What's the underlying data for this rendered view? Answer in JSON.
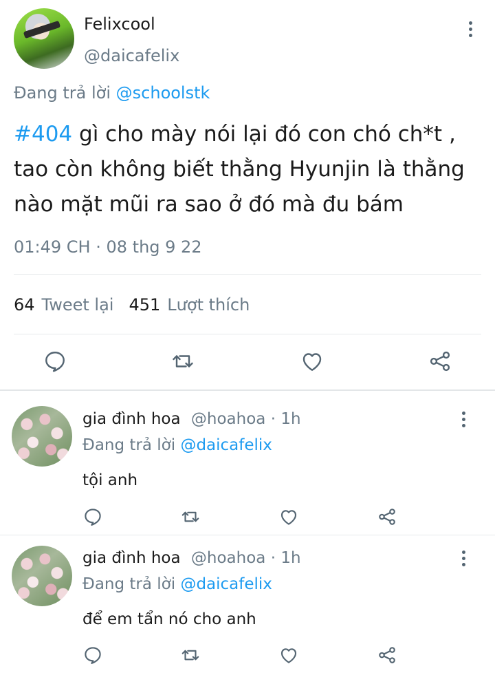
{
  "tweet": {
    "display_name": "Felixcool",
    "handle": "@daicafelix",
    "replying_prefix": "Đang trả lời",
    "replying_to": "@schoolstk",
    "hashtag": "#404",
    "text": " gì cho mày nói lại đó con chó ch*t , tao còn không biết thằng Hyunjin là thằng nào mặt mũi ra sao ở đó mà đu bám",
    "timestamp": "01:49 CH · 08 thg 9 22",
    "retweets_count": "64",
    "retweets_label": "Tweet lại",
    "likes_count": "451",
    "likes_label": "Lượt thích",
    "more_icon": "more-vertical-icon"
  },
  "replies": [
    {
      "display_name": "gia đình hoa",
      "handle": "@hoahoa",
      "time": "· 1h",
      "replying_prefix": "Đang trả lời",
      "replying_to": "@daicafelix",
      "text": "tội anh"
    },
    {
      "display_name": "gia đình hoa",
      "handle": "@hoahoa",
      "time": "· 1h",
      "replying_prefix": "Đang trả lời",
      "replying_to": "@daicafelix",
      "text": "để em tẩn nó cho anh"
    }
  ],
  "actions": {
    "reply_icon": "reply-icon",
    "retweet_icon": "retweet-icon",
    "like_icon": "heart-icon",
    "share_icon": "share-icon"
  },
  "colors": {
    "accent": "#1d9bf0",
    "muted": "#6b7b88",
    "icon": "#536471",
    "divider": "#e6e9eb"
  }
}
